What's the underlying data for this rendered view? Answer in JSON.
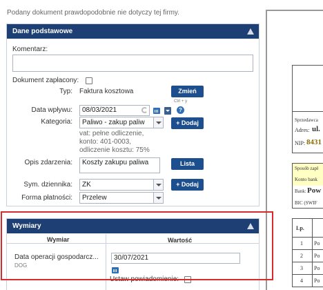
{
  "notice": "Podany dokument prawdopodobnie nie dotyczy tej firmy.",
  "basic_panel": {
    "title": "Dane podstawowe",
    "comment_label": "Komentarz:",
    "comment_value": "",
    "paid_label": "Dokument zapłacony:",
    "type_label": "Typ:",
    "type_value": "Faktura kosztowa",
    "change_button": "Zmień",
    "shortcut_hint": "Ctrl + y",
    "received_label": "Data wpływu:",
    "received_value": "08/03/2021",
    "category_label": "Kategoria:",
    "category_value": "Paliwo - zakup paliw",
    "category_details": [
      "vat: pełne odliczenie,",
      "konto: 401-0003,",
      "odliczenie kosztu: 75%"
    ],
    "add_button": "+ Dodaj",
    "event_label": "Opis zdarzenia:",
    "event_value": "Koszty zakupu paliwa",
    "list_button": "Lista",
    "journal_label": "Sym. dziennika:",
    "journal_value": "ZK",
    "add_button_2": "+ Dodaj",
    "payment_label": "Forma płatności:",
    "payment_value": "Przelew"
  },
  "dims_panel": {
    "title": "Wymiary",
    "col_dim": "Wymiar",
    "col_value": "Wartość",
    "row_name": "Data operacji gospodarcz...",
    "row_code": "DOG",
    "row_value": "30/07/2021",
    "reminder_label": "Ustaw powiadomienie:"
  },
  "document_preview": {
    "seller_label": "Sprzedawca",
    "address_label": "Adres:",
    "address_value": "ul.",
    "nip_label": "NIP:",
    "nip_value": "8431",
    "payment_method_label": "Sposób zapł",
    "bank_account_label": "Konto bank",
    "bank_label": "Bank:",
    "bank_value": "Pow",
    "bic_label": "BIC (SWIF",
    "col_lp": "Lp.",
    "rows": [
      {
        "lp": "1",
        "name": "Po"
      },
      {
        "lp": "2",
        "name": "Po"
      },
      {
        "lp": "3",
        "name": "Po"
      },
      {
        "lp": "4",
        "name": "Po"
      }
    ]
  },
  "colors": {
    "panel_header": "#1d3f73",
    "button": "#1d4f8f",
    "highlight": "#d62b2b",
    "preview_yellow": "#ffffc4"
  }
}
